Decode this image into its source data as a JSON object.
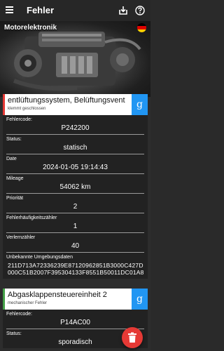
{
  "appbar": {
    "title": "Fehler"
  },
  "hero": {
    "title": "Motorelektronik"
  },
  "card1": {
    "name": "entlüftungssystem, Belüftungsventil",
    "status_text": "klemmt geschlossen",
    "search_letter": "g",
    "accent": "#e53935",
    "fields": [
      {
        "label": "Fehlercode:",
        "value": "P242200"
      },
      {
        "label": "Status:",
        "value": "statisch"
      },
      {
        "label": "Date",
        "value": "2024-01-05 19:14:43"
      },
      {
        "label": "Mileage",
        "value": "54062 km"
      },
      {
        "label": "Priorität",
        "value": "2"
      },
      {
        "label": "Fehlerhäufigkeitszähler",
        "value": "1"
      },
      {
        "label": "Verlernzähler",
        "value": "40"
      },
      {
        "label": "Unbekannte Umgebungsdaten",
        "value": "211D713A72336239E87120962851B3000C427D000C51B2007F395304133F8551B50011DC01A8"
      }
    ]
  },
  "card2": {
    "name": "Abgasklappensteuereinheit 2",
    "status_text": "mechanischer Fehler",
    "search_letter": "g",
    "accent": "#43a047",
    "fields": [
      {
        "label": "Fehlercode:",
        "value": "P14AC00"
      },
      {
        "label": "Status:",
        "value": "sporadisch"
      }
    ]
  },
  "colors": {
    "appbar": "#272727",
    "card_body": "#222222",
    "google_button": "#2196f3",
    "fab": "#e53935"
  }
}
